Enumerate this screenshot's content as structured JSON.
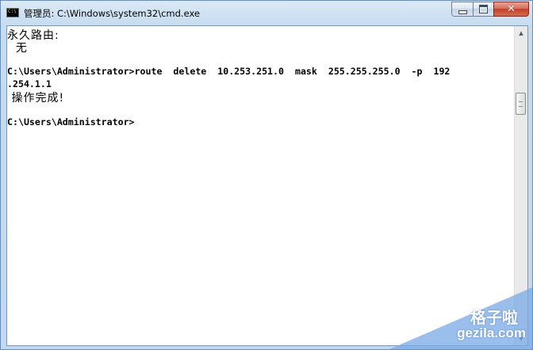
{
  "window": {
    "title": "管理员: C:\\Windows\\system32\\cmd.exe",
    "icon": "cmd-icon",
    "buttons": {
      "minimize": "minimize-icon",
      "maximize": "maximize-icon",
      "close": "close-icon"
    }
  },
  "console": {
    "lines": [
      "永久路由:",
      "  无",
      "",
      "C:\\Users\\Administrator>route  delete  10.253.251.0  mask  255.255.255.0  -p  192",
      ".254.1.1",
      " 操作完成!",
      "",
      "C:\\Users\\Administrator>"
    ]
  },
  "watermark": {
    "brand": "格子啦",
    "domain": "gezila.com",
    "color": "#78aae6"
  }
}
